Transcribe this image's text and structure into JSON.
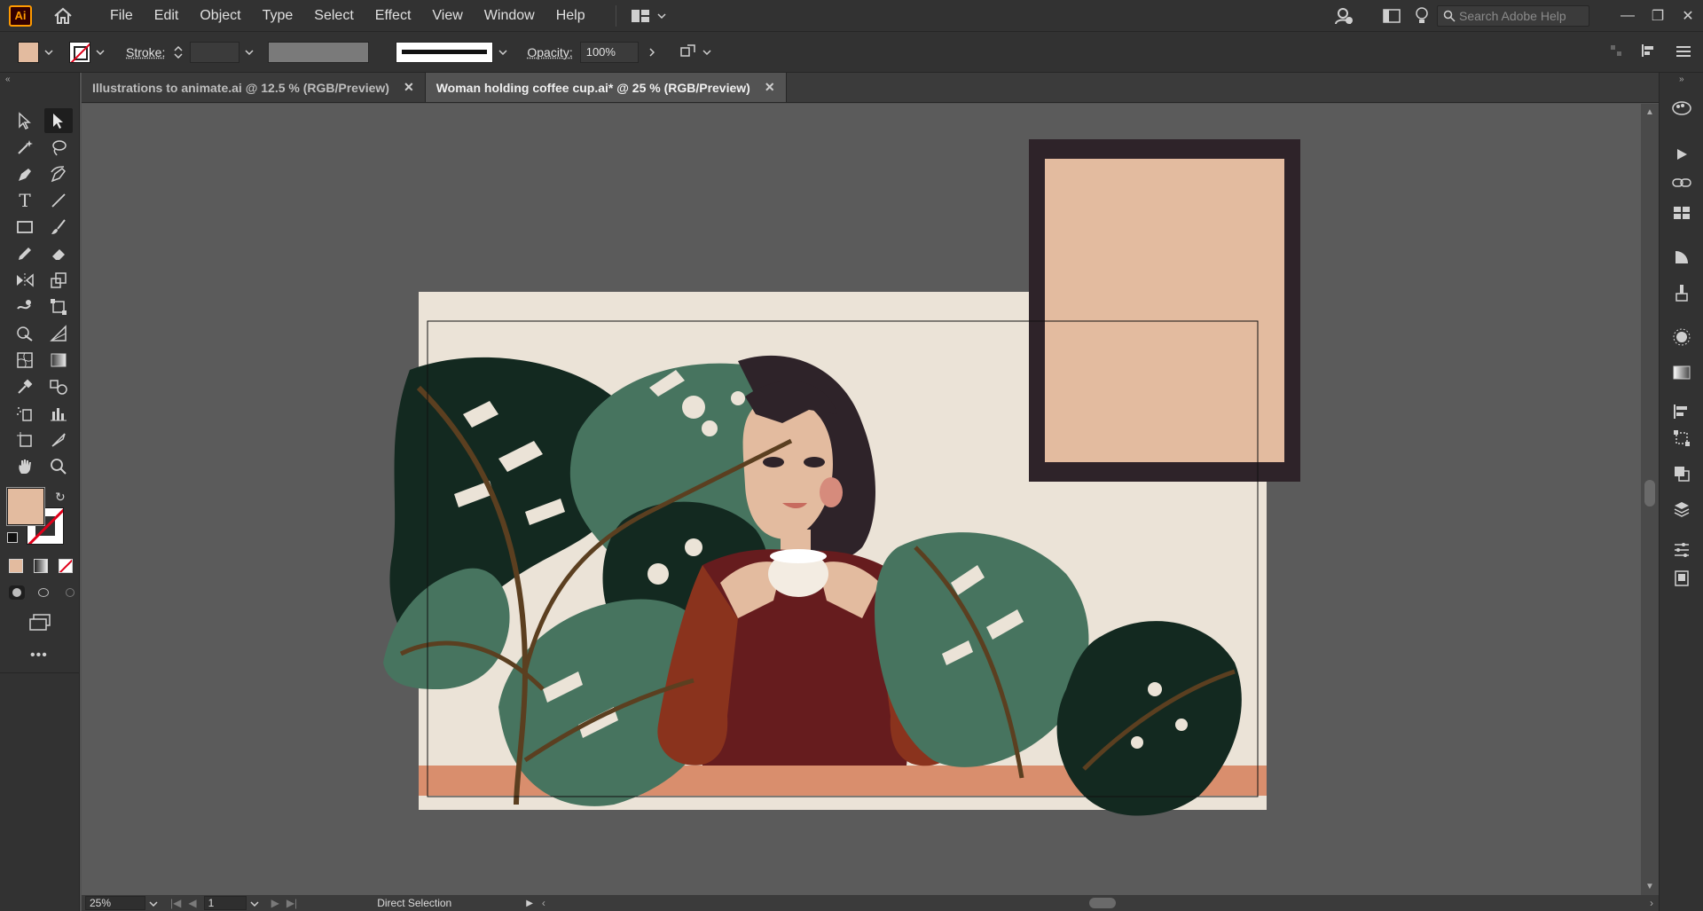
{
  "app": {
    "logo_text": "Ai"
  },
  "menu": [
    "File",
    "Edit",
    "Object",
    "Type",
    "Select",
    "Effect",
    "View",
    "Window",
    "Help"
  ],
  "search": {
    "placeholder": "Search Adobe Help"
  },
  "control_bar": {
    "fill_color": "#e3bb9f",
    "stroke_label": "Stroke:",
    "opacity_label": "Opacity:",
    "opacity_value": "100%"
  },
  "tabs": [
    {
      "label": "Illustrations to animate.ai @ 12.5 % (RGB/Preview)",
      "active": false
    },
    {
      "label": "Woman holding coffee cup.ai* @ 25 % (RGB/Preview)",
      "active": true
    }
  ],
  "status": {
    "zoom": "25%",
    "artboard": "1",
    "tool": "Direct Selection"
  },
  "colors": {
    "canvas_bg": "#5b5b5b",
    "artboard_bg": "#ebe3d7",
    "frame_dark": "#2e2329",
    "frame_inner": "#e3bb9f",
    "table": "#d98e6d",
    "leaf_dark": "#132920",
    "leaf_green": "#47745f",
    "stem": "#5b3f20",
    "sweater": "#661c1e",
    "sleeve": "#8a331d",
    "skin": "#e3bb9f",
    "hair": "#2e2329"
  }
}
